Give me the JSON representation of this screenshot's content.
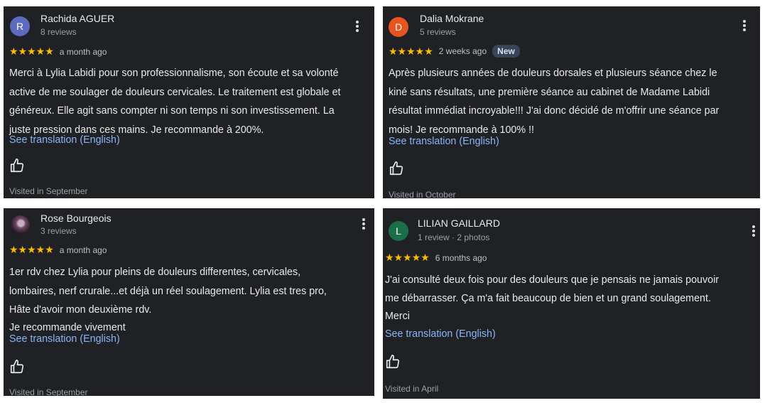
{
  "colors": {
    "card_bg": "#202124",
    "star": "#fbbc04",
    "link": "#8ab4f8",
    "avatar_r": "#5c6bc0",
    "avatar_d": "#e8541f",
    "avatar_l": "#1b6e4a"
  },
  "reviews": [
    {
      "author": "Rachida AGUER",
      "avatar_letter": "R",
      "meta": "8 reviews",
      "stars": "★★★★★",
      "rating": 5,
      "time_ago": "a month ago",
      "text_lines": [
        "Merci à Lylia Labidi pour son professionnalisme, son écoute et sa volonté",
        "active de me soulager de douleurs cervicales. Le traitement est globale et",
        "généreux. Elle agit sans compter ni son temps ni son investissement. La",
        "juste pression dans ces mains. Je recommande à 200%."
      ],
      "translate_label": "See translation (English)",
      "visited": "Visited in September"
    },
    {
      "author": "Dalia Mokrane",
      "avatar_letter": "D",
      "meta": "5 reviews",
      "stars": "★★★★★",
      "rating": 5,
      "time_ago": "2 weeks ago",
      "badge": "New",
      "text_lines": [
        "Après plusieurs années de douleurs dorsales et plusieurs séance chez le",
        "kiné sans résultats, une première séance au cabinet de Madame Labidi",
        "résultat immédiat incroyable!!! J'ai donc décidé de m'offrir une séance par",
        "mois! Je recommande à 100% !!"
      ],
      "translate_label": "See translation (English)",
      "visited": "Visited in October"
    },
    {
      "author": "Rose Bourgeois",
      "meta": "3 reviews",
      "stars": "★★★★★",
      "rating": 5,
      "time_ago": "a month ago",
      "text_lines": [
        "1er rdv chez Lylia pour pleins de douleurs differentes, cervicales,",
        "lombaires, nerf crurale...et déjà un réel soulagement. Lylia est tres pro,",
        "Hâte d'avoir mon deuxième rdv.",
        "Je recommande vivement"
      ],
      "translate_label": "See translation (English)",
      "visited": "Visited in September"
    },
    {
      "author": "LILIAN GAILLARD",
      "avatar_letter": "L",
      "meta": "1 review · 2 photos",
      "stars": "★★★★★",
      "rating": 5,
      "time_ago": "6 months ago",
      "text_lines": [
        "J'ai consulté deux fois pour des douleurs que je pensais ne jamais pouvoir",
        "me débarrasser. Ça m'a fait beaucoup de bien et un grand soulagement.",
        "Merci"
      ],
      "translate_label": "See translation (English)",
      "visited": "Visited in April"
    }
  ]
}
